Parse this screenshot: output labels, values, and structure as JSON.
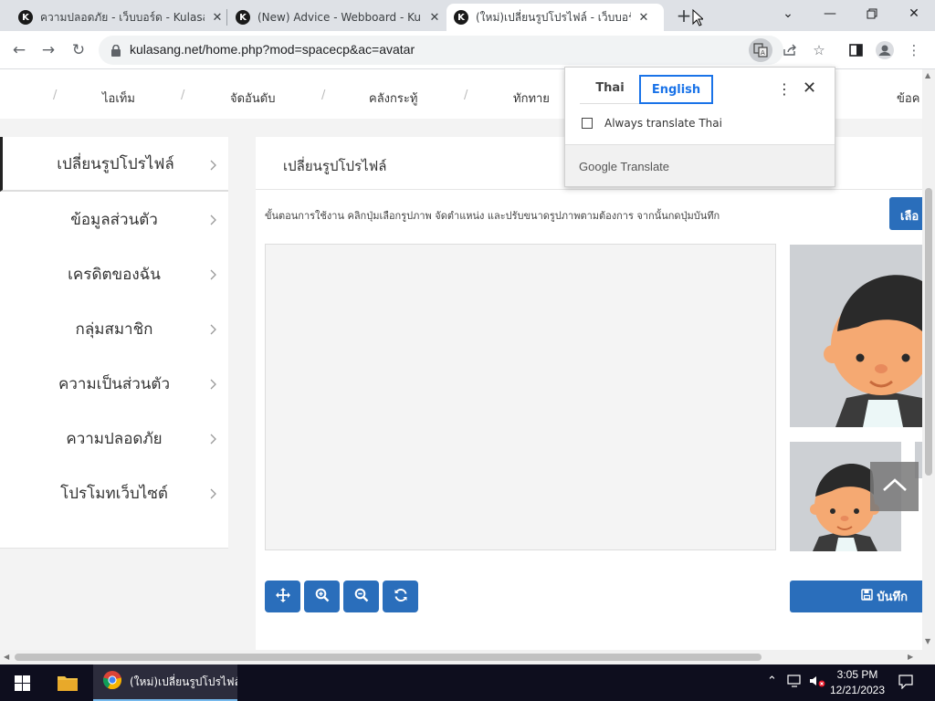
{
  "browser": {
    "tabs": [
      {
        "title": "ความปลอดภัย - เว็บบอร์ด - Kulasang"
      },
      {
        "title": "(New) Advice - Webboard - Kula"
      },
      {
        "title": "(ใหม่)เปลี่ยนรูปโปรไฟล์ - เว็บบอร์ด - K"
      }
    ],
    "favicon_letter": "K",
    "active_tab": 2,
    "url": "kulasang.net/home.php?mod=spacecp&ac=avatar"
  },
  "site_nav": {
    "items": [
      "ไอเท็ม",
      "จัดอันดับ",
      "คลังกระทู้",
      "ทักทาย",
      "ข้อค"
    ]
  },
  "sidebar": {
    "items": [
      {
        "label": "เปลี่ยนรูปโปรไฟล์"
      },
      {
        "label": "ข้อมูลส่วนตัว"
      },
      {
        "label": "เครดิตของฉัน"
      },
      {
        "label": "กลุ่มสมาชิก"
      },
      {
        "label": "ความเป็นส่วนตัว"
      },
      {
        "label": "ความปลอดภัย"
      },
      {
        "label": "โปรโมทเว็บไซต์"
      }
    ]
  },
  "main": {
    "title": "เปลี่ยนรูปโปรไฟล์",
    "instructions": "ขั้นตอนการใช้งาน คลิกปุ่มเลือกรูปภาพ จัดตำแหน่ง และปรับขนาดรูปภาพตามต้องการ จากนั้นกดปุ่มบันทึก",
    "select_button": "เลือ",
    "save_button": "บันทึก"
  },
  "translate_popup": {
    "tab_source": "Thai",
    "tab_target": "English",
    "always_translate": "Always translate Thai",
    "footer_brand": "Google",
    "footer_product": "Translate"
  },
  "taskbar": {
    "chrome_label": "(ใหม่)เปลี่ยนรูปโปรไฟล์...",
    "time": "3:05 PM",
    "date": "12/21/2023"
  },
  "colors": {
    "primary_button": "#2a6ebb",
    "translate_accent": "#1a73e8"
  }
}
